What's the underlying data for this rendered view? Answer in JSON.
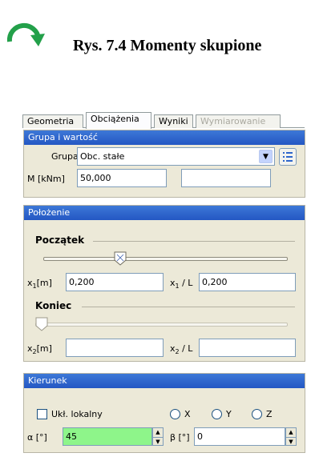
{
  "header": {
    "title": "Rys. 7.4 Momenty skupione",
    "icon": "rotate-arrow-icon",
    "icon_color": "#23a04a"
  },
  "tabs": [
    {
      "label": "Geometria",
      "state": "normal"
    },
    {
      "label": "Obciążenia",
      "state": "active"
    },
    {
      "label": "Wyniki",
      "state": "normal"
    },
    {
      "label": "Wymiarowanie",
      "state": "disabled"
    }
  ],
  "group_panel": {
    "title": "Grupa i wartość",
    "group_label": "Grupa",
    "group_value": "Obc. stałe",
    "moment_label": "M [kNm]",
    "moment_value": "50,000",
    "extra_value": ""
  },
  "position_panel": {
    "title": "Położenie",
    "start_label": "Początek",
    "start_slider_level": 0.2,
    "x1_label_prefix": "x",
    "x1_label_sub": "1",
    "x1_label_suffix": "[m]",
    "x1_value": "0,200",
    "x1l_label_prefix": "x",
    "x1l_label_sub": "1",
    "x1l_label_suffix": "/ L",
    "x1l_value": "0,200",
    "end_label": "Koniec",
    "end_slider_level": 0.0,
    "x2_label_prefix": "x",
    "x2_label_sub": "2",
    "x2_label_suffix": "[m]",
    "x2_value": "",
    "x2l_label_prefix": "x",
    "x2l_label_sub": "2",
    "x2l_label_suffix": "/ L",
    "x2l_value": ""
  },
  "direction_panel": {
    "title": "Kierunek",
    "local_label": "Ukł. lokalny",
    "local_checked": false,
    "radio_x": "X",
    "radio_y": "Y",
    "radio_z": "Z",
    "alpha_label": "α [°]",
    "alpha_value": "45",
    "alpha_bg": "#8ef58a",
    "beta_label": "β [°]",
    "beta_value": "0"
  },
  "colors": {
    "accent": "#2e66cc",
    "panel_bg": "#ece9d8"
  }
}
